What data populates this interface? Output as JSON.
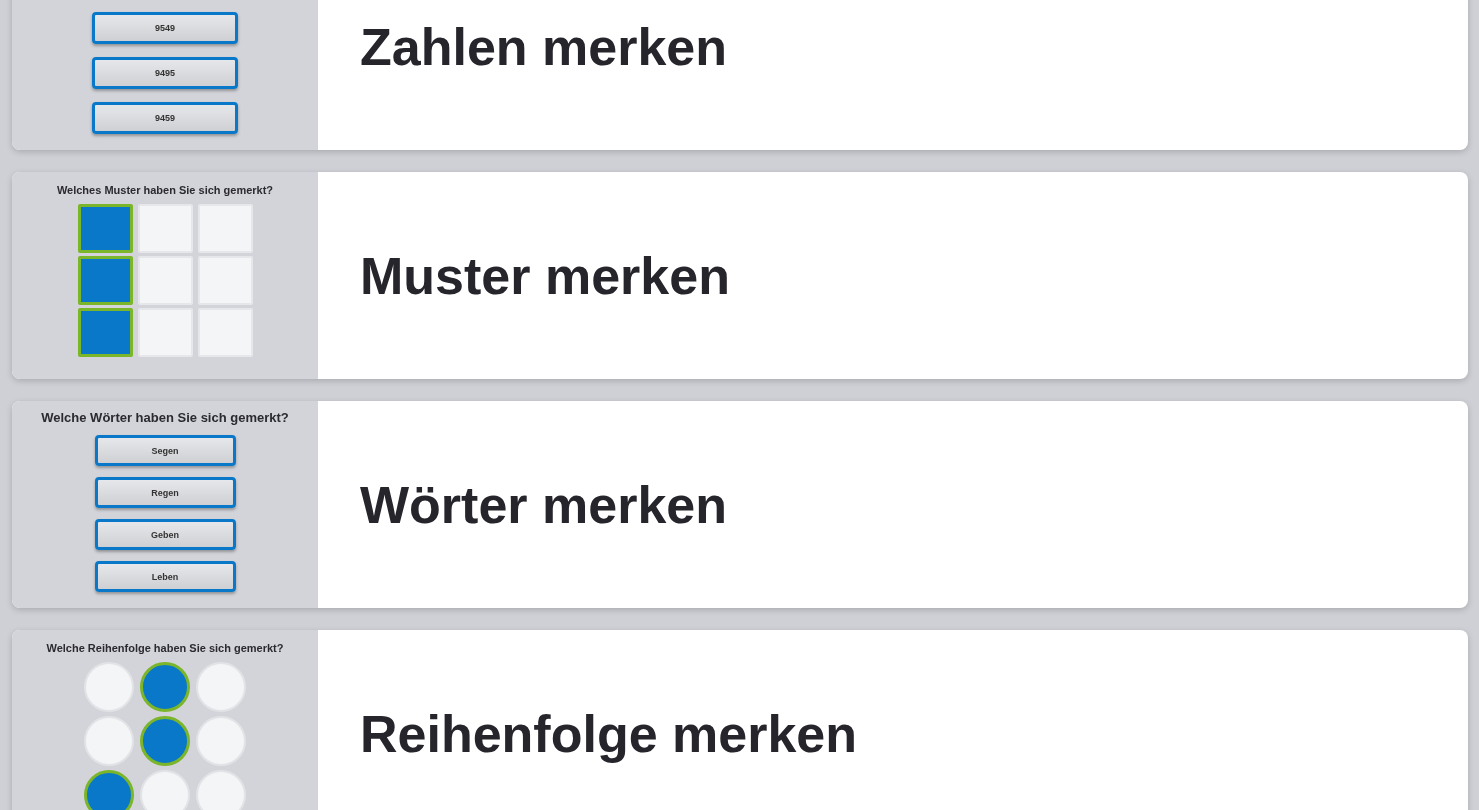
{
  "cards": [
    {
      "kind": "choices",
      "title": "Zahlen merken",
      "options": [
        "9549",
        "9495",
        "9459"
      ]
    },
    {
      "kind": "grid",
      "question": "Welches Muster haben Sie sich gemerkt?",
      "title": "Muster merken",
      "cells": [
        {
          "selected": true
        },
        {
          "selected": false
        },
        {
          "selected": false
        },
        {
          "selected": true
        },
        {
          "selected": false
        },
        {
          "selected": false
        },
        {
          "selected": true
        },
        {
          "selected": false
        },
        {
          "selected": false
        }
      ]
    },
    {
      "kind": "choices",
      "question": "Welche Wörter haben Sie sich gemerkt?",
      "title": "Wörter merken",
      "options": [
        "Segen",
        "Regen",
        "Geben",
        "Leben"
      ]
    },
    {
      "kind": "dots",
      "question": "Welche Reihenfolge haben Sie sich gemerkt?",
      "title": "Reihenfolge merken",
      "cells": [
        {
          "selected": false
        },
        {
          "selected": true
        },
        {
          "selected": false
        },
        {
          "selected": false
        },
        {
          "selected": true
        },
        {
          "selected": false
        },
        {
          "selected": true
        },
        {
          "selected": false
        },
        {
          "selected": false
        }
      ]
    }
  ]
}
